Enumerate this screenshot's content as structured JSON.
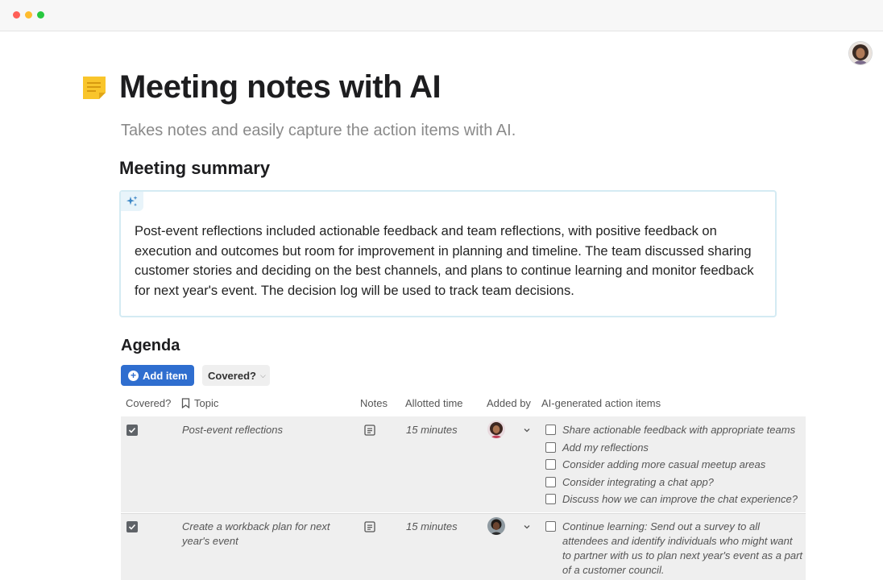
{
  "page": {
    "title": "Meeting notes with AI",
    "subtitle": "Takes notes and easily capture the action items with AI.",
    "icon": "sticky-note-icon"
  },
  "summary": {
    "heading": "Meeting summary",
    "badge_icon": "sparkles-icon",
    "text": "Post-event reflections included actionable feedback and team reflections, with positive feedback on execution and outcomes but room for improvement in planning and timeline. The team discussed sharing customer stories and deciding on the best channels, and plans to continue learning and monitor feedback for next year's event. The decision log will be used to track team decisions."
  },
  "agenda": {
    "heading": "Agenda",
    "add_button": "Add item",
    "filter_button": "Covered?",
    "columns": {
      "covered": "Covered?",
      "topic": "Topic",
      "notes": "Notes",
      "time": "Allotted time",
      "added_by": "Added by",
      "actions": "AI-generated action items"
    },
    "rows": [
      {
        "covered": true,
        "topic": "Post-event reflections",
        "time": "15 minutes",
        "actions": [
          "Share actionable feedback with appropriate teams",
          "Add my reflections",
          "Consider adding more casual meetup areas",
          "Consider integrating a chat app?",
          "Discuss how we can improve the chat experience?"
        ]
      },
      {
        "covered": true,
        "topic": "Create a workback plan for next year's event",
        "time": "15 minutes",
        "actions": [
          "Continue learning: Send out a survey to all attendees and identify individuals who might want to partner with us to plan next year's event as a part of a customer council."
        ]
      }
    ]
  },
  "colors": {
    "accent": "#2f6ecf",
    "row_bg": "#efefef",
    "ai_border": "#d4ebf3"
  }
}
